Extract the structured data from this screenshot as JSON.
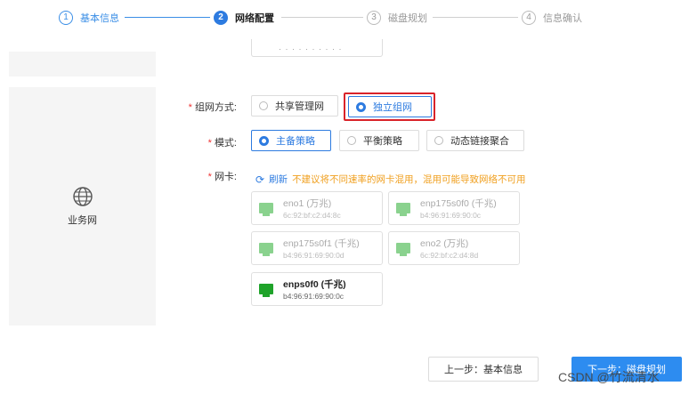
{
  "stepper": {
    "steps": [
      {
        "num": "1",
        "label": "基本信息"
      },
      {
        "num": "2",
        "label": "网络配置"
      },
      {
        "num": "3",
        "label": "磁盘规划"
      },
      {
        "num": "4",
        "label": "信息确认"
      }
    ]
  },
  "sidebar": {
    "section_title": "业务网"
  },
  "top_cutoff": {
    "value": "· · · · · · · · · ·"
  },
  "form": {
    "networking": {
      "label": "组网方式:",
      "options": [
        "共享管理网",
        "独立组网"
      ],
      "selected": "独立组网"
    },
    "mode": {
      "label": "模式:",
      "options": [
        "主备策略",
        "平衡策略",
        "动态链接聚合"
      ],
      "selected": "主备策略"
    },
    "nic": {
      "label": "网卡:",
      "refresh_label": "刷新",
      "warning": "不建议将不同速率的网卡混用，混用可能导致网络不可用",
      "cards": [
        {
          "name": "eno1 (万兆)",
          "mac": "6c:92:bf:c2:d4:8c",
          "selected": false
        },
        {
          "name": "enp175s0f0 (千兆)",
          "mac": "b4:96:91:69:90:0c",
          "selected": false
        },
        {
          "name": "enp175s0f1 (千兆)",
          "mac": "b4:96:91:69:90:0d",
          "selected": false
        },
        {
          "name": "eno2 (万兆)",
          "mac": "6c:92:bf:c2:d4:8d",
          "selected": false
        },
        {
          "name": "enps0f0 (千兆)",
          "mac": "b4:96:91:69:90:0c",
          "selected": true
        }
      ]
    }
  },
  "footer": {
    "prev_label": "上一步：基本信息",
    "next_label": "下一步：磁盘规划"
  },
  "watermark": "CSDN @竹流清水",
  "colors": {
    "primary": "#2d7be0",
    "required": "#e33333",
    "warning": "#f0a020",
    "highlight": "#d9232a",
    "nic_active": "#1fa32a"
  }
}
